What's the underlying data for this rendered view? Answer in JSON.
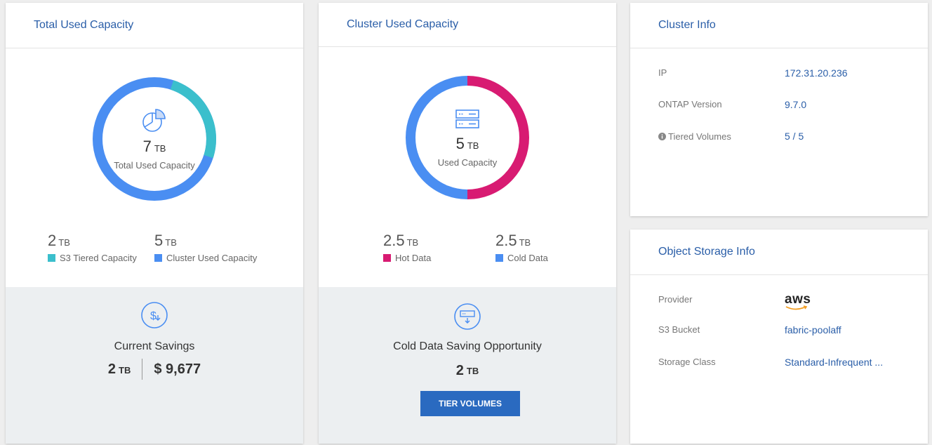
{
  "colors": {
    "teal": "#3bbfcc",
    "blue": "#4a8ef2",
    "pink": "#d81b72",
    "link": "#2a5ea8",
    "button": "#2a6ac0"
  },
  "total": {
    "title": "Total Used Capacity",
    "center_value": "7",
    "center_unit": "TB",
    "center_label": "Total Used Capacity",
    "stats": [
      {
        "value": "2",
        "unit": "TB",
        "label": "S3 Tiered Capacity",
        "color": "#3bbfcc"
      },
      {
        "value": "5",
        "unit": "TB",
        "label": "Cluster Used Capacity",
        "color": "#4a8ef2"
      }
    ],
    "footer_icon": "dollar-circle-icon",
    "footer_title": "Current Savings",
    "savings_value": "2",
    "savings_unit": "TB",
    "savings_money": "$ 9,677"
  },
  "cluster": {
    "title": "Cluster Used Capacity",
    "center_value": "5",
    "center_unit": "TB",
    "center_label": "Used Capacity",
    "stats": [
      {
        "value": "2.5",
        "unit": "TB",
        "label": "Hot Data",
        "color": "#d81b72"
      },
      {
        "value": "2.5",
        "unit": "TB",
        "label": "Cold Data",
        "color": "#4a8ef2"
      }
    ],
    "footer_icon": "storage-download-icon",
    "footer_title": "Cold Data Saving Opportunity",
    "opportunity_value": "2",
    "opportunity_unit": "TB",
    "button_label": "TIER VOLUMES"
  },
  "cluster_info": {
    "title": "Cluster Info",
    "rows": [
      {
        "label": "IP",
        "value": "172.31.20.236"
      },
      {
        "label": "ONTAP Version",
        "value": "9.7.0"
      },
      {
        "label": "Tiered Volumes",
        "value": "5 / 5",
        "icon": "info-icon"
      }
    ]
  },
  "object_storage": {
    "title": "Object Storage Info",
    "rows": [
      {
        "label": "Provider",
        "value": "aws"
      },
      {
        "label": "S3 Bucket",
        "value": "fabric-poolaff"
      },
      {
        "label": "Storage Class",
        "value": "Standard-Infrequent ..."
      }
    ]
  }
}
